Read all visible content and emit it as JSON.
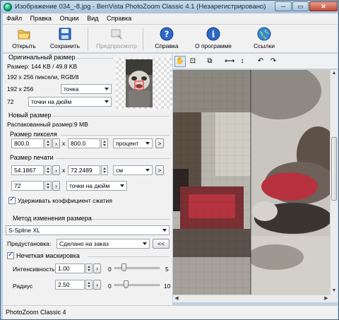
{
  "window": {
    "title": "Изображение 034_-8.jpg - BenVista PhotoZoom Classic 4.1 (Незарегистрировано)",
    "minimize_label": "─",
    "maximize_label": "▭",
    "close_label": "✕"
  },
  "menu": [
    "Файл",
    "Правка",
    "Опции",
    "Вид",
    "Справка"
  ],
  "toolbar": {
    "open_label": "Открыть",
    "save_label": "Сохранить",
    "preview_label": "Предпросмотр",
    "help_label": "Справка",
    "about_label": "О программе",
    "links_label": "Ссылки"
  },
  "original_size": {
    "title": "Оригинальный размер",
    "size_line": "Размер: 144 KB / 49.8 KB",
    "pixels_line": "192 x 256 пиксели, RGB/8",
    "dims": "192 x 256",
    "dims_unit": "точка",
    "dpi": "72",
    "dpi_unit": "точки на дюйм"
  },
  "new_size": {
    "title": "Новый размер",
    "unpacked": "Распакованный размер:9 MB",
    "pixel_size_title": "Размер пикселя",
    "pixel_w": "800.0",
    "pixel_h": "800.0",
    "pixel_unit": "процент",
    "print_size_title": "Размер печати",
    "print_w": "54.1867",
    "print_h": "72.2489",
    "print_unit": "см",
    "res": "72",
    "res_unit": "точки на дюйм",
    "x_sep": "x",
    "next_btn": ">",
    "keep_ratio_label": "Удерживать коэффициент сжатия",
    "keep_ratio_checked": true
  },
  "method": {
    "title": "Метод изменения размера",
    "value": "S-Spline XL",
    "preset_label": "Предустановка:",
    "preset_value": "Сделано на заказ",
    "preset_btn": "<<"
  },
  "unsharp": {
    "title": "Нечеткая маскировка",
    "checked": true,
    "intensity_label": "Интенсивность",
    "intensity_value": "1.00",
    "intensity_min": "0",
    "intensity_max": "5",
    "intensity_level": 0.2,
    "radius_label": "Радиус",
    "radius_value": "2.50",
    "radius_min": "0",
    "radius_max": "10",
    "radius_level": 0.25
  },
  "status": "PhotoZoom Classic 4",
  "colors": {
    "accent": "#1a5fb4",
    "window_frame": "#b9d1e6"
  }
}
